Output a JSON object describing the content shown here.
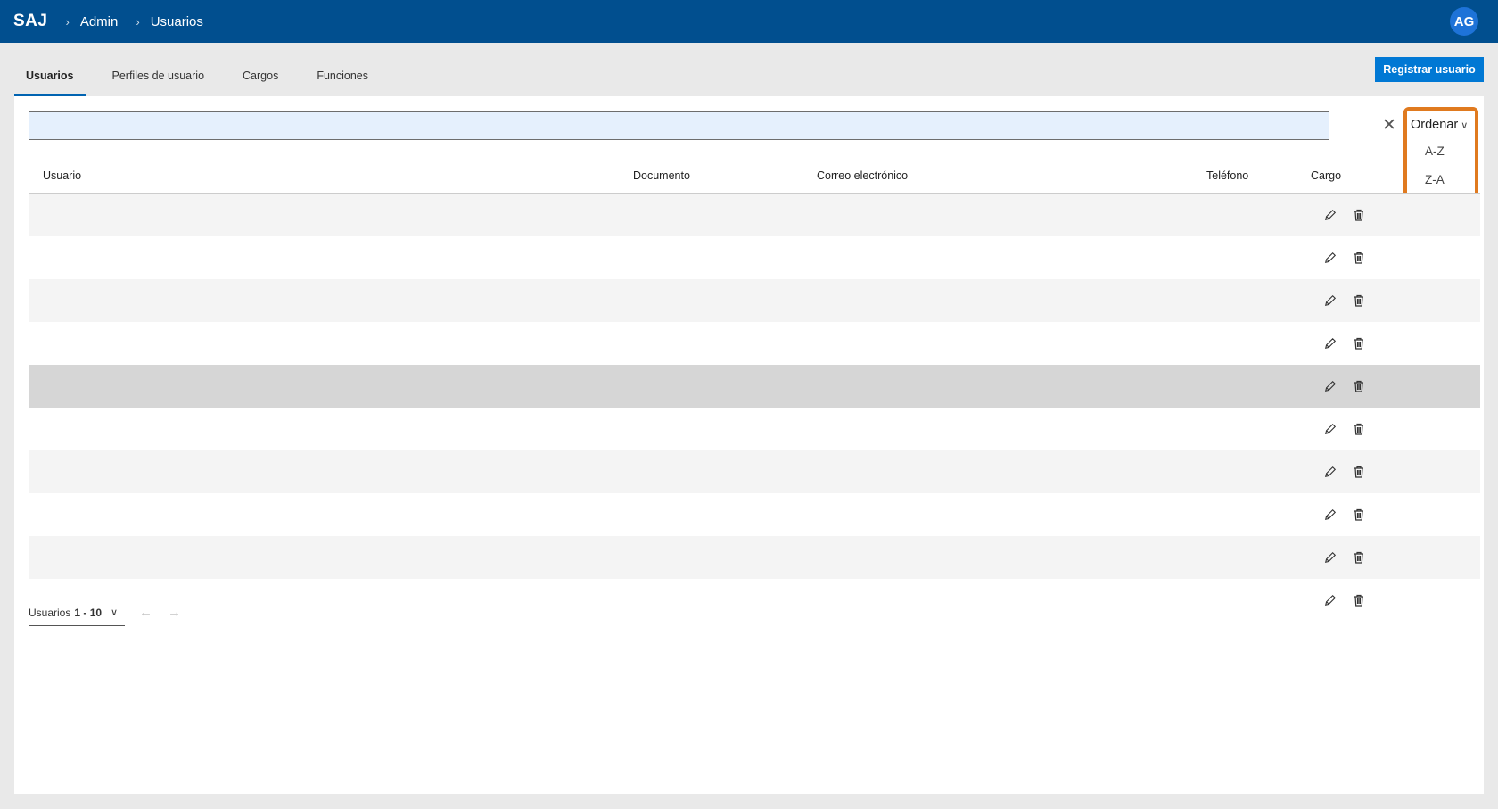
{
  "header": {
    "brand": "SAJ",
    "breadcrumb": [
      "Admin",
      "Usuarios"
    ],
    "avatar_initials": "AG"
  },
  "tabs": [
    {
      "label": "Usuarios",
      "active": true
    },
    {
      "label": "Perfiles de usuario",
      "active": false
    },
    {
      "label": "Cargos",
      "active": false
    },
    {
      "label": "Funciones",
      "active": false
    }
  ],
  "actions": {
    "register_label": "Registrar usuario"
  },
  "search": {
    "value": "",
    "clear_icon": "close-icon"
  },
  "sort": {
    "label": "Ordenar",
    "options": [
      "A-Z",
      "Z-A"
    ],
    "highlight_color": "#e07a1f"
  },
  "table": {
    "columns": [
      "Usuario",
      "Documento",
      "Correo electrónico",
      "Teléfono",
      "Cargo"
    ],
    "rows": [
      {
        "usuario": "",
        "documento": "",
        "correo": "",
        "telefono": "",
        "cargo": ""
      },
      {
        "usuario": "",
        "documento": "",
        "correo": "",
        "telefono": "",
        "cargo": ""
      },
      {
        "usuario": "",
        "documento": "",
        "correo": "",
        "telefono": "",
        "cargo": ""
      },
      {
        "usuario": "",
        "documento": "",
        "correo": "",
        "telefono": "",
        "cargo": ""
      },
      {
        "usuario": "",
        "documento": "",
        "correo": "",
        "telefono": "",
        "cargo": ""
      },
      {
        "usuario": "",
        "documento": "",
        "correo": "",
        "telefono": "",
        "cargo": ""
      },
      {
        "usuario": "",
        "documento": "",
        "correo": "",
        "telefono": "",
        "cargo": ""
      },
      {
        "usuario": "",
        "documento": "",
        "correo": "",
        "telefono": "",
        "cargo": ""
      },
      {
        "usuario": "",
        "documento": "",
        "correo": "",
        "telefono": "",
        "cargo": ""
      },
      {
        "usuario": "",
        "documento": "",
        "correo": "",
        "telefono": "",
        "cargo": ""
      }
    ],
    "row_icons": [
      "pencil-icon",
      "trash-icon"
    ]
  },
  "pagination": {
    "label": "Usuarios",
    "range": "1 - 10"
  },
  "colors": {
    "topbar": "#014f8f",
    "accent": "#0078d4",
    "avatar": "#1e73d8"
  }
}
